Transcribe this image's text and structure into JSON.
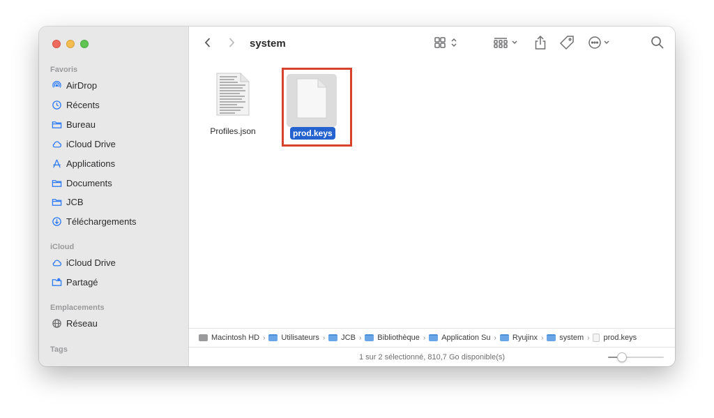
{
  "window": {
    "title": "system"
  },
  "sidebar": {
    "sections": {
      "favorites": "Favoris",
      "icloud": "iCloud",
      "locations": "Emplacements",
      "tags": "Tags"
    },
    "favorites": [
      {
        "label": "AirDrop",
        "icon": "airdrop-icon"
      },
      {
        "label": "Récents",
        "icon": "clock-icon"
      },
      {
        "label": "Bureau",
        "icon": "folder-icon"
      },
      {
        "label": "iCloud Drive",
        "icon": "cloud-icon"
      },
      {
        "label": "Applications",
        "icon": "applications-icon"
      },
      {
        "label": "Documents",
        "icon": "folder-icon"
      },
      {
        "label": "JCB",
        "icon": "folder-icon"
      },
      {
        "label": "Téléchargements",
        "icon": "download-icon"
      }
    ],
    "icloud": [
      {
        "label": "iCloud Drive",
        "icon": "cloud-icon"
      },
      {
        "label": "Partagé",
        "icon": "shared-folder-icon"
      }
    ],
    "locations": [
      {
        "label": "Réseau",
        "icon": "globe-icon"
      }
    ]
  },
  "files": [
    {
      "name": "Profiles.json",
      "icon": "document-thumbnail-icon",
      "selected": false
    },
    {
      "name": "prod.keys",
      "icon": "blank-document-icon",
      "selected": true
    }
  ],
  "pathbar": [
    {
      "label": "Macintosh HD",
      "icon": "disk-icon"
    },
    {
      "label": "Utilisateurs",
      "icon": "folder-icon"
    },
    {
      "label": "JCB",
      "icon": "folder-icon"
    },
    {
      "label": "Bibliothèque",
      "icon": "folder-icon"
    },
    {
      "label": "Application Su",
      "icon": "folder-icon"
    },
    {
      "label": "Ryujinx",
      "icon": "folder-icon"
    },
    {
      "label": "system",
      "icon": "folder-icon"
    },
    {
      "label": "prod.keys",
      "icon": "document-icon"
    }
  ],
  "pathbar_separator": "›",
  "status": {
    "text": "1 sur 2 sélectionné, 810,7 Go disponible(s)"
  },
  "icon_slider": {
    "value": 0.25
  },
  "colors": {
    "accent": "#2f7bf6",
    "selection": "#2462d0",
    "highlight_box": "#d6422e",
    "sidebar_bg": "#e8e8e9"
  }
}
